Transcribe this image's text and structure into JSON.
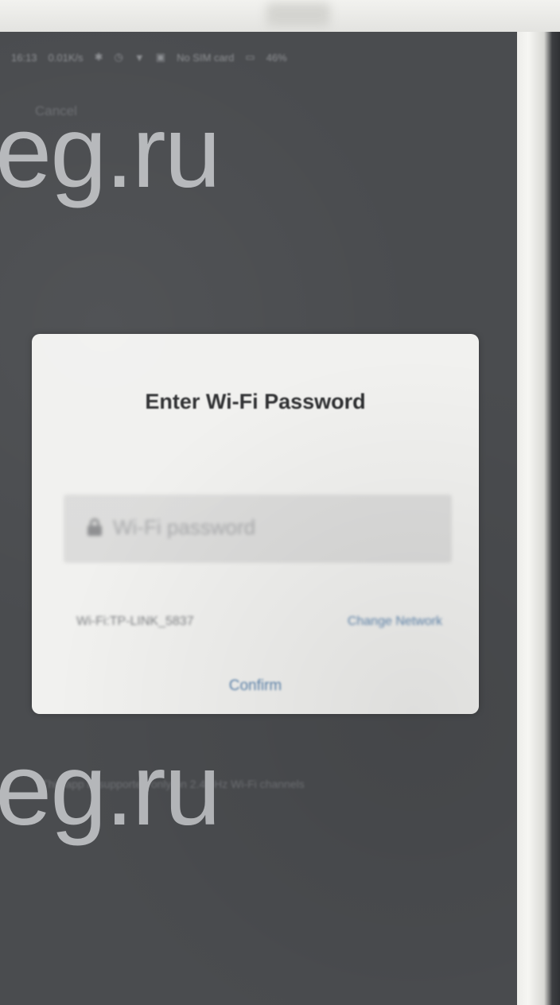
{
  "status_bar": {
    "time": "16:13",
    "speed": "0.01K/s",
    "carrier": "No SIM card",
    "battery": "46%",
    "icons": [
      "signal-icon",
      "bluetooth-icon",
      "alarm-icon",
      "wifi-icon",
      "sim-icon",
      "battery-icon"
    ]
  },
  "nav": {
    "cancel_label": "Cancel"
  },
  "watermark": {
    "text_top": "eg.ru",
    "text_bottom": "eg.ru"
  },
  "dialog": {
    "title": "Enter Wi-Fi Password",
    "password_placeholder": "Wi-Fi password",
    "network_label": "Wi-Fi:TP-LINK_5837",
    "change_network_label": "Change Network",
    "confirm_label": "Confirm"
  },
  "footer_note": "This app is supported only on 2.4GHz Wi-Fi channels",
  "colors": {
    "screen_bg": "#4a4c4f",
    "dialog_bg": "#f1f1ef",
    "accent_link": "#5d84ad",
    "watermark": "#b6b8bb"
  }
}
